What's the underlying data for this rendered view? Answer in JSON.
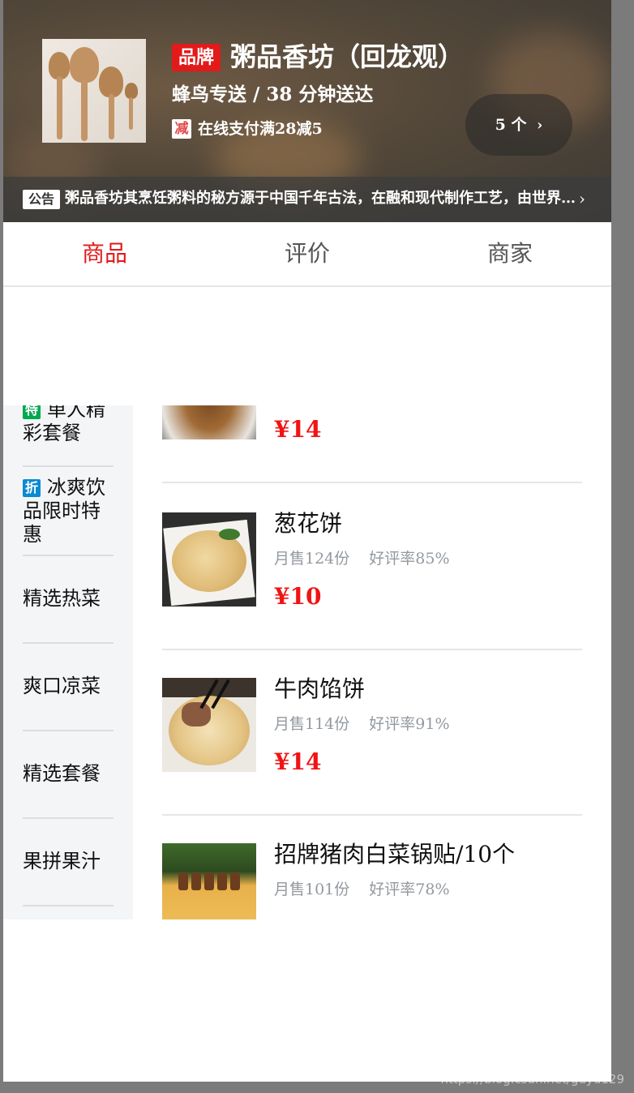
{
  "header": {
    "brand_badge": "品牌",
    "shop_name": "粥品香坊（回龙观）",
    "delivery_info": "蜂鸟专送 / 38 分钟送达",
    "discount_badge": "减",
    "discount_text": "在线支付满28减5",
    "coupon_label": "5 个",
    "notice_badge": "公告",
    "notice_text": "粥品香坊其烹饪粥料的秘方源于中国千年古法，在融和现代制作工艺，由世界..."
  },
  "tabs": [
    {
      "label": "商品",
      "active": true
    },
    {
      "label": "评价",
      "active": false
    },
    {
      "label": "商家",
      "active": false
    }
  ],
  "menu": [
    {
      "tag": "特",
      "tag_color": "#00a950",
      "label": "单人精彩套餐"
    },
    {
      "tag": "折",
      "tag_color": "#0a8ad3",
      "label": "冰爽饮品限时特惠"
    },
    {
      "tag": "",
      "label": "精选热菜"
    },
    {
      "tag": "",
      "label": "爽口凉菜"
    },
    {
      "tag": "",
      "label": "精选套餐"
    },
    {
      "tag": "",
      "label": "果拼果汁"
    }
  ],
  "foods": [
    {
      "name": "",
      "sales": "",
      "rating": "",
      "price": "¥14"
    },
    {
      "name": "葱花饼",
      "sales": "月售124份",
      "rating": "好评率85%",
      "price": "¥10"
    },
    {
      "name": "牛肉馅饼",
      "sales": "月售114份",
      "rating": "好评率91%",
      "price": "¥14"
    },
    {
      "name": "招牌猪肉白菜锅贴/10个",
      "sales": "月售101份",
      "rating": "好评率78%",
      "price": ""
    }
  ],
  "watermark": "https://blog.csdn.net/guyu129",
  "colors": {
    "accent": "#e21a1a",
    "price": "#f01414",
    "menu_bg": "#f3f5f7"
  }
}
